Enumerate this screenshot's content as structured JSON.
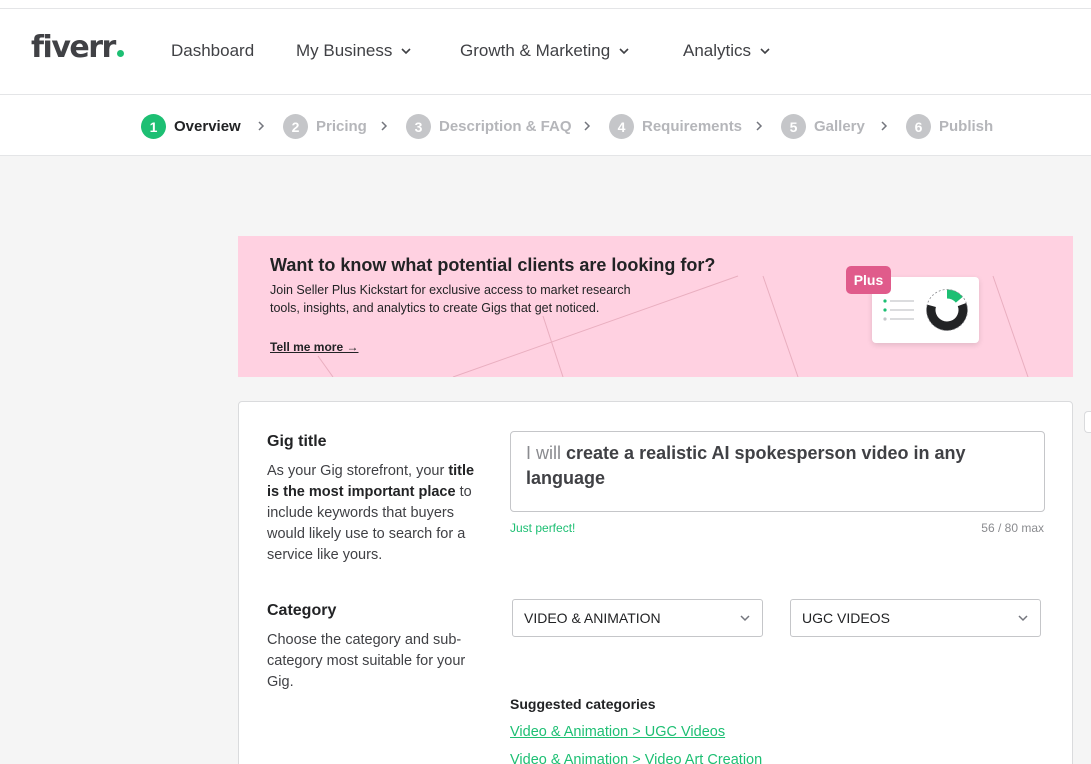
{
  "brand": {
    "logo_text": "fiverr",
    "accent": "#1dbf73",
    "promo_bg": "#ffd1e1",
    "plus_color": "#e05b8b"
  },
  "nav": {
    "items": [
      {
        "label": "Dashboard",
        "has_dropdown": false
      },
      {
        "label": "My Business",
        "has_dropdown": true
      },
      {
        "label": "Growth & Marketing",
        "has_dropdown": true
      },
      {
        "label": "Analytics",
        "has_dropdown": true
      }
    ]
  },
  "steps": [
    {
      "num": "1",
      "label": "Overview",
      "active": true
    },
    {
      "num": "2",
      "label": "Pricing",
      "active": false
    },
    {
      "num": "3",
      "label": "Description & FAQ",
      "active": false
    },
    {
      "num": "4",
      "label": "Requirements",
      "active": false
    },
    {
      "num": "5",
      "label": "Gallery",
      "active": false
    },
    {
      "num": "6",
      "label": "Publish",
      "active": false
    }
  ],
  "promo": {
    "title": "Want to know what potential clients are looking for?",
    "body": "Join Seller Plus Kickstart for exclusive access to market research tools, insights, and analytics to create Gigs that get noticed.",
    "link": "Tell me more →",
    "badge": "Plus"
  },
  "gig_title": {
    "heading": "Gig title",
    "desc_pre": "As your Gig storefront, your ",
    "desc_bold": "title is the most important place",
    "desc_post": " to include keywords that buyers would likely use to search for a service like yours.",
    "prefix": "I will",
    "value": "create a realistic AI spokesperson video in any language",
    "hint": "Just perfect!",
    "counter": "56 / 80 max"
  },
  "category": {
    "heading": "Category",
    "desc": "Choose the category and sub-category most suitable for your Gig.",
    "main_value": "VIDEO & ANIMATION",
    "sub_value": "UGC VIDEOS",
    "suggested_title": "Suggested categories",
    "suggested": [
      "Video & Animation > UGC Videos",
      "Video & Animation > Video Art Creation"
    ]
  }
}
